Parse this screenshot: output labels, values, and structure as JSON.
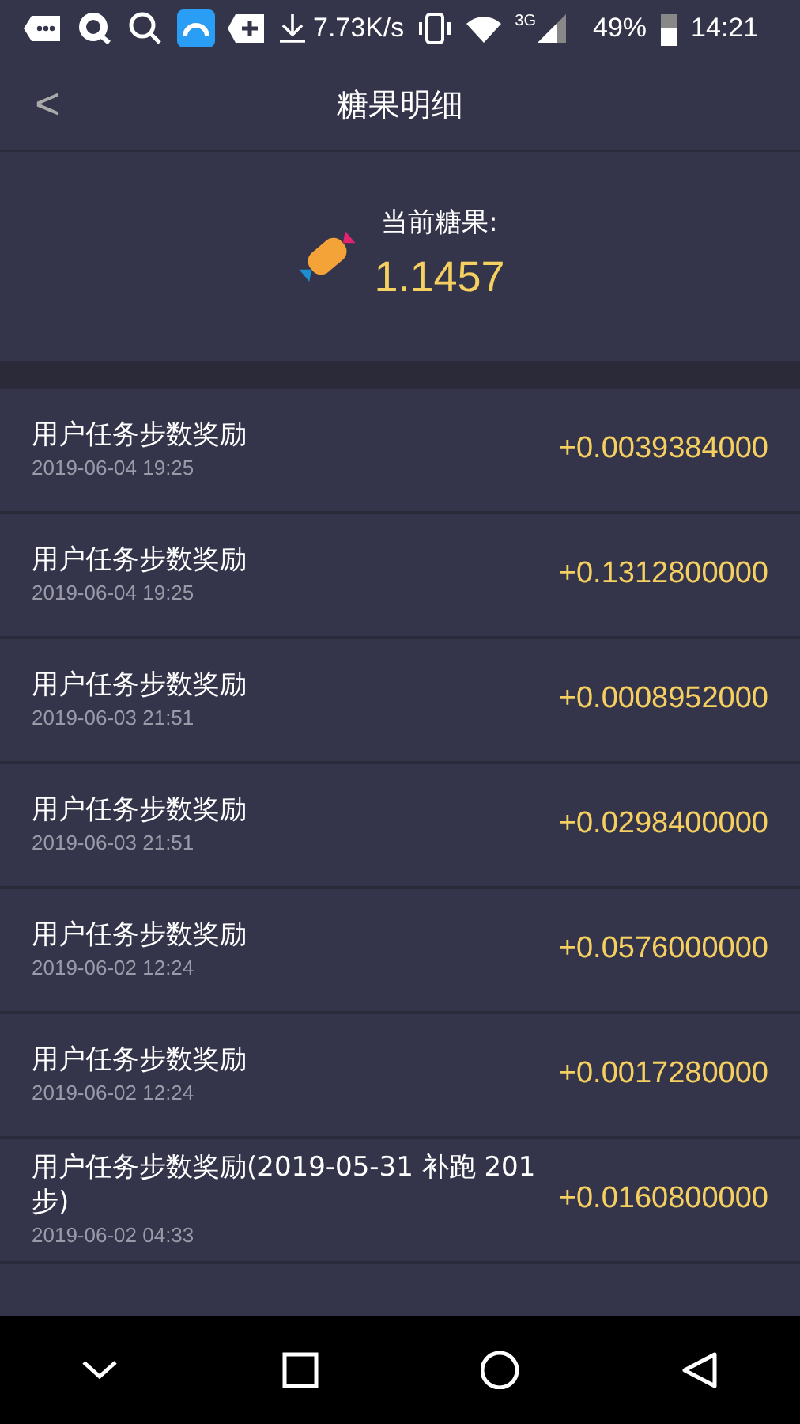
{
  "status_bar": {
    "speed": "7.73K/s",
    "network": "3G",
    "battery": "49%",
    "time": "14:21"
  },
  "header": {
    "back": "<",
    "title": "糖果明细"
  },
  "summary": {
    "label": "当前糖果:",
    "amount": "1.1457"
  },
  "records": [
    {
      "title": "用户任务步数奖励",
      "date": "2019-06-04 19:25",
      "amount": "+0.0039384000"
    },
    {
      "title": "用户任务步数奖励",
      "date": "2019-06-04 19:25",
      "amount": "+0.1312800000"
    },
    {
      "title": "用户任务步数奖励",
      "date": "2019-06-03 21:51",
      "amount": "+0.0008952000"
    },
    {
      "title": "用户任务步数奖励",
      "date": "2019-06-03 21:51",
      "amount": "+0.0298400000"
    },
    {
      "title": "用户任务步数奖励",
      "date": "2019-06-02 12:24",
      "amount": "+0.0576000000"
    },
    {
      "title": "用户任务步数奖励",
      "date": "2019-06-02 12:24",
      "amount": "+0.0017280000"
    },
    {
      "title": "用户任务步数奖励(2019-05-31 补跑 201步)",
      "date": "2019-06-02 04:33",
      "amount": "+0.0160800000"
    }
  ]
}
